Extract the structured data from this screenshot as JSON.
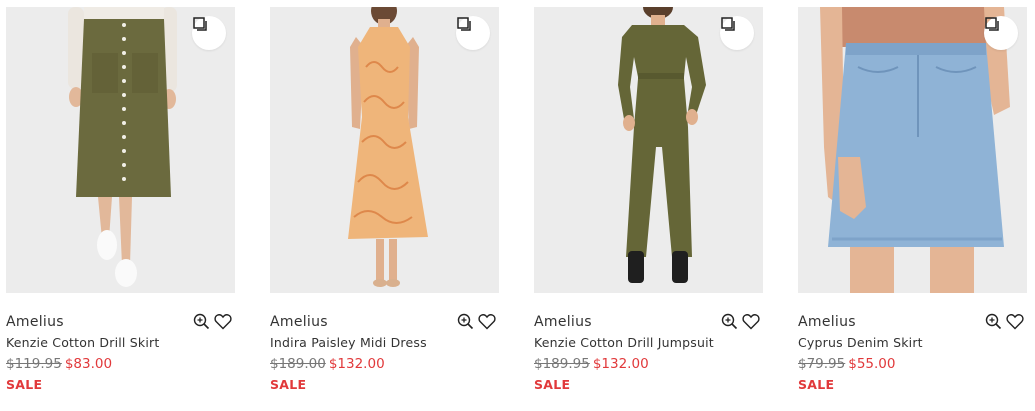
{
  "colors": {
    "sale_red": "#e1393b",
    "image_bg": "#ececec",
    "text": "#333333"
  },
  "products": [
    {
      "brand": "Amelius",
      "name": "Kenzie Cotton Drill Skirt",
      "old_price": "$119.95",
      "new_price": "$83.00",
      "badge": "SALE"
    },
    {
      "brand": "Amelius",
      "name": "Indira Paisley Midi Dress",
      "old_price": "$189.00",
      "new_price": "$132.00",
      "badge": "SALE"
    },
    {
      "brand": "Amelius",
      "name": "Kenzie Cotton Drill Jumpsuit",
      "old_price": "$189.95",
      "new_price": "$132.00",
      "badge": "SALE"
    },
    {
      "brand": "Amelius",
      "name": "Cyprus Denim Skirt",
      "old_price": "$79.95",
      "new_price": "$55.00",
      "badge": "SALE"
    }
  ],
  "icons": {
    "quick_view": "quick-view-icon",
    "zoom": "zoom-in-icon",
    "wishlist": "heart-icon"
  }
}
